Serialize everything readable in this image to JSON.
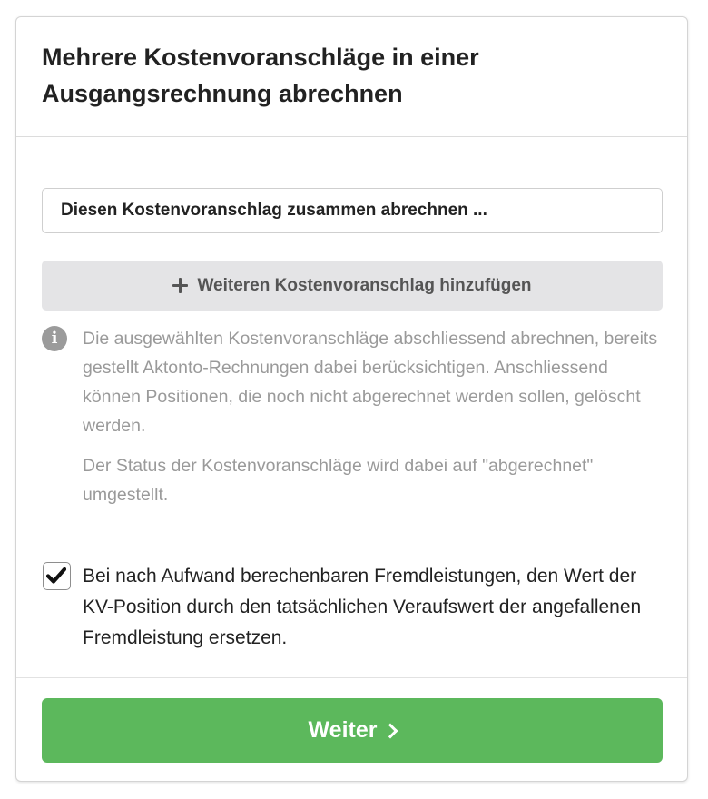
{
  "dialog": {
    "title": "Mehrere Kostenvoranschläge in einer Ausgangsrechnung abrechnen"
  },
  "estimate_select": {
    "value": "Diesen Kostenvoranschlag zusammen abrechnen ..."
  },
  "add_estimate_button": {
    "label": "Weiteren Kostenvoranschlag hinzufügen",
    "icon": "plus-icon"
  },
  "info": {
    "icon": "info-circle-icon",
    "paragraph_1": "Die ausgewählten Kostenvoranschläge abschliessend abrechnen, bereits gestellt Aktonto-Rechnungen dabei berücksichtigen. Anschliessend können Positionen, die noch nicht abgerechnet werden sollen, gelöscht werden.",
    "paragraph_2": "Der Status der Kostenvoranschläge wird dabei auf \"abgerechnet\" umgestellt."
  },
  "replace_value_option": {
    "checked": true,
    "label": "Bei nach Aufwand berechenbaren Fremdleistungen, den Wert der KV-Position durch den tatsächlichen Veraufswert der angefallenen Fremdleistung ersetzen."
  },
  "next_button": {
    "label": "Weiter",
    "icon": "chevron-right-icon"
  },
  "colors": {
    "primary_button": "#5cb85c",
    "secondary_button": "#e4e4e6",
    "info_text": "#9a9a9a",
    "title_text": "#222222"
  }
}
